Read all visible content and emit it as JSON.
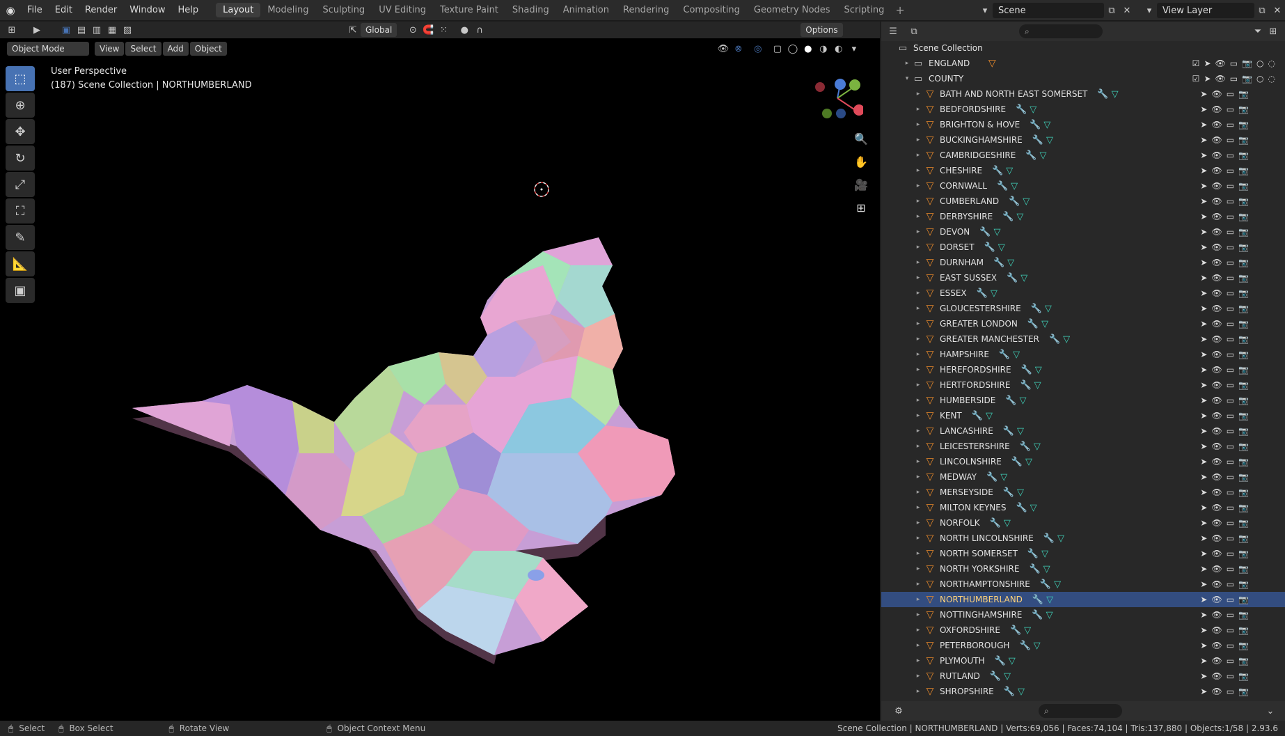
{
  "menu": [
    "File",
    "Edit",
    "Render",
    "Window",
    "Help"
  ],
  "workspaces": [
    "Layout",
    "Modeling",
    "Sculpting",
    "UV Editing",
    "Texture Paint",
    "Shading",
    "Animation",
    "Rendering",
    "Compositing",
    "Geometry Nodes",
    "Scripting"
  ],
  "active_workspace": "Layout",
  "scene": "Scene",
  "view_layer": "View Layer",
  "viewport": {
    "transform_orientation": "Global",
    "options_label": "Options",
    "mode": "Object Mode",
    "header_menus": [
      "View",
      "Select",
      "Add",
      "Object"
    ],
    "overlay_line1": "User Perspective",
    "overlay_line2": "(187) Scene Collection | NORTHUMBERLAND"
  },
  "outliner": {
    "root": "Scene Collection",
    "collections": [
      {
        "name": "ENGLAND",
        "expanded": false
      },
      {
        "name": "COUNTY",
        "expanded": true
      }
    ],
    "objects": [
      "BATH AND NORTH EAST SOMERSET",
      "BEDFORDSHIRE",
      "BRIGHTON & HOVE",
      "BUCKINGHAMSHIRE",
      "CAMBRIDGESHIRE",
      "CHESHIRE",
      "CORNWALL",
      "CUMBERLAND",
      "DERBYSHIRE",
      "DEVON",
      "DORSET",
      "DURNHAM",
      "EAST SUSSEX",
      "ESSEX",
      "GLOUCESTERSHIRE",
      "GREATER LONDON",
      "GREATER MANCHESTER",
      "HAMPSHIRE",
      "HEREFORDSHIRE",
      "HERTFORDSHIRE",
      "HUMBERSIDE",
      "KENT",
      "LANCASHIRE",
      "LEICESTERSHIRE",
      "LINCOLNSHIRE",
      "MEDWAY",
      "MERSEYSIDE",
      "MILTON KEYNES",
      "NORFOLK",
      "NORTH LINCOLNSHIRE",
      "NORTH SOMERSET",
      "NORTH YORKSHIRE",
      "NORTHAMPTONSHIRE",
      "NORTHUMBERLAND",
      "NOTTINGHAMSHIRE",
      "OXFORDSHIRE",
      "PETERBOROUGH",
      "PLYMOUTH",
      "RUTLAND",
      "SHROPSHIRE"
    ],
    "selected": "NORTHUMBERLAND"
  },
  "status": {
    "select": "Select",
    "box_select": "Box Select",
    "rotate": "Rotate View",
    "context": "Object Context Menu",
    "stats": "Scene Collection | NORTHUMBERLAND | Verts:69,056 | Faces:74,104 | Tris:137,880 | Objects:1/58 | 2.93.6"
  },
  "colors": {
    "accent": "#4772b3",
    "selection": "#334d80",
    "mesh_icon": "#e98a2b"
  }
}
